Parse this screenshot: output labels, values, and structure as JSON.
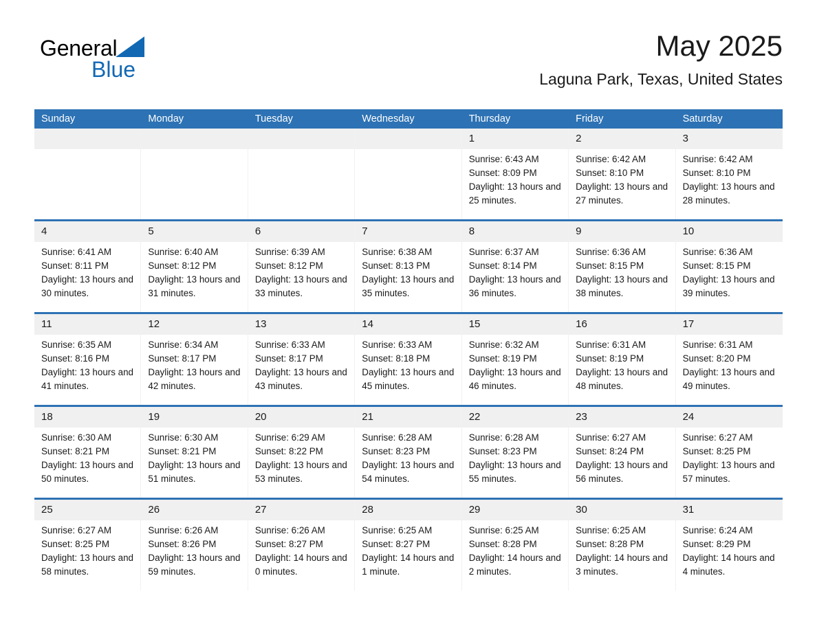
{
  "brand": {
    "name_part1": "General",
    "name_part2": "Blue",
    "accent_color": "#1268b3"
  },
  "header": {
    "month_title": "May 2025",
    "location": "Laguna Park, Texas, United States"
  },
  "colors": {
    "header_bar": "#2d72b4",
    "day_band": "#f0f0f0",
    "text": "#1a1a1a"
  },
  "weekdays": [
    "Sunday",
    "Monday",
    "Tuesday",
    "Wednesday",
    "Thursday",
    "Friday",
    "Saturday"
  ],
  "weeks": [
    [
      {
        "day": "",
        "sunrise": "",
        "sunset": "",
        "daylight": "",
        "empty": true
      },
      {
        "day": "",
        "sunrise": "",
        "sunset": "",
        "daylight": "",
        "empty": true
      },
      {
        "day": "",
        "sunrise": "",
        "sunset": "",
        "daylight": "",
        "empty": true
      },
      {
        "day": "",
        "sunrise": "",
        "sunset": "",
        "daylight": "",
        "empty": true
      },
      {
        "day": "1",
        "sunrise": "Sunrise: 6:43 AM",
        "sunset": "Sunset: 8:09 PM",
        "daylight": "Daylight: 13 hours and 25 minutes.",
        "empty": false
      },
      {
        "day": "2",
        "sunrise": "Sunrise: 6:42 AM",
        "sunset": "Sunset: 8:10 PM",
        "daylight": "Daylight: 13 hours and 27 minutes.",
        "empty": false
      },
      {
        "day": "3",
        "sunrise": "Sunrise: 6:42 AM",
        "sunset": "Sunset: 8:10 PM",
        "daylight": "Daylight: 13 hours and 28 minutes.",
        "empty": false
      }
    ],
    [
      {
        "day": "4",
        "sunrise": "Sunrise: 6:41 AM",
        "sunset": "Sunset: 8:11 PM",
        "daylight": "Daylight: 13 hours and 30 minutes.",
        "empty": false
      },
      {
        "day": "5",
        "sunrise": "Sunrise: 6:40 AM",
        "sunset": "Sunset: 8:12 PM",
        "daylight": "Daylight: 13 hours and 31 minutes.",
        "empty": false
      },
      {
        "day": "6",
        "sunrise": "Sunrise: 6:39 AM",
        "sunset": "Sunset: 8:12 PM",
        "daylight": "Daylight: 13 hours and 33 minutes.",
        "empty": false
      },
      {
        "day": "7",
        "sunrise": "Sunrise: 6:38 AM",
        "sunset": "Sunset: 8:13 PM",
        "daylight": "Daylight: 13 hours and 35 minutes.",
        "empty": false
      },
      {
        "day": "8",
        "sunrise": "Sunrise: 6:37 AM",
        "sunset": "Sunset: 8:14 PM",
        "daylight": "Daylight: 13 hours and 36 minutes.",
        "empty": false
      },
      {
        "day": "9",
        "sunrise": "Sunrise: 6:36 AM",
        "sunset": "Sunset: 8:15 PM",
        "daylight": "Daylight: 13 hours and 38 minutes.",
        "empty": false
      },
      {
        "day": "10",
        "sunrise": "Sunrise: 6:36 AM",
        "sunset": "Sunset: 8:15 PM",
        "daylight": "Daylight: 13 hours and 39 minutes.",
        "empty": false
      }
    ],
    [
      {
        "day": "11",
        "sunrise": "Sunrise: 6:35 AM",
        "sunset": "Sunset: 8:16 PM",
        "daylight": "Daylight: 13 hours and 41 minutes.",
        "empty": false
      },
      {
        "day": "12",
        "sunrise": "Sunrise: 6:34 AM",
        "sunset": "Sunset: 8:17 PM",
        "daylight": "Daylight: 13 hours and 42 minutes.",
        "empty": false
      },
      {
        "day": "13",
        "sunrise": "Sunrise: 6:33 AM",
        "sunset": "Sunset: 8:17 PM",
        "daylight": "Daylight: 13 hours and 43 minutes.",
        "empty": false
      },
      {
        "day": "14",
        "sunrise": "Sunrise: 6:33 AM",
        "sunset": "Sunset: 8:18 PM",
        "daylight": "Daylight: 13 hours and 45 minutes.",
        "empty": false
      },
      {
        "day": "15",
        "sunrise": "Sunrise: 6:32 AM",
        "sunset": "Sunset: 8:19 PM",
        "daylight": "Daylight: 13 hours and 46 minutes.",
        "empty": false
      },
      {
        "day": "16",
        "sunrise": "Sunrise: 6:31 AM",
        "sunset": "Sunset: 8:19 PM",
        "daylight": "Daylight: 13 hours and 48 minutes.",
        "empty": false
      },
      {
        "day": "17",
        "sunrise": "Sunrise: 6:31 AM",
        "sunset": "Sunset: 8:20 PM",
        "daylight": "Daylight: 13 hours and 49 minutes.",
        "empty": false
      }
    ],
    [
      {
        "day": "18",
        "sunrise": "Sunrise: 6:30 AM",
        "sunset": "Sunset: 8:21 PM",
        "daylight": "Daylight: 13 hours and 50 minutes.",
        "empty": false
      },
      {
        "day": "19",
        "sunrise": "Sunrise: 6:30 AM",
        "sunset": "Sunset: 8:21 PM",
        "daylight": "Daylight: 13 hours and 51 minutes.",
        "empty": false
      },
      {
        "day": "20",
        "sunrise": "Sunrise: 6:29 AM",
        "sunset": "Sunset: 8:22 PM",
        "daylight": "Daylight: 13 hours and 53 minutes.",
        "empty": false
      },
      {
        "day": "21",
        "sunrise": "Sunrise: 6:28 AM",
        "sunset": "Sunset: 8:23 PM",
        "daylight": "Daylight: 13 hours and 54 minutes.",
        "empty": false
      },
      {
        "day": "22",
        "sunrise": "Sunrise: 6:28 AM",
        "sunset": "Sunset: 8:23 PM",
        "daylight": "Daylight: 13 hours and 55 minutes.",
        "empty": false
      },
      {
        "day": "23",
        "sunrise": "Sunrise: 6:27 AM",
        "sunset": "Sunset: 8:24 PM",
        "daylight": "Daylight: 13 hours and 56 minutes.",
        "empty": false
      },
      {
        "day": "24",
        "sunrise": "Sunrise: 6:27 AM",
        "sunset": "Sunset: 8:25 PM",
        "daylight": "Daylight: 13 hours and 57 minutes.",
        "empty": false
      }
    ],
    [
      {
        "day": "25",
        "sunrise": "Sunrise: 6:27 AM",
        "sunset": "Sunset: 8:25 PM",
        "daylight": "Daylight: 13 hours and 58 minutes.",
        "empty": false
      },
      {
        "day": "26",
        "sunrise": "Sunrise: 6:26 AM",
        "sunset": "Sunset: 8:26 PM",
        "daylight": "Daylight: 13 hours and 59 minutes.",
        "empty": false
      },
      {
        "day": "27",
        "sunrise": "Sunrise: 6:26 AM",
        "sunset": "Sunset: 8:27 PM",
        "daylight": "Daylight: 14 hours and 0 minutes.",
        "empty": false
      },
      {
        "day": "28",
        "sunrise": "Sunrise: 6:25 AM",
        "sunset": "Sunset: 8:27 PM",
        "daylight": "Daylight: 14 hours and 1 minute.",
        "empty": false
      },
      {
        "day": "29",
        "sunrise": "Sunrise: 6:25 AM",
        "sunset": "Sunset: 8:28 PM",
        "daylight": "Daylight: 14 hours and 2 minutes.",
        "empty": false
      },
      {
        "day": "30",
        "sunrise": "Sunrise: 6:25 AM",
        "sunset": "Sunset: 8:28 PM",
        "daylight": "Daylight: 14 hours and 3 minutes.",
        "empty": false
      },
      {
        "day": "31",
        "sunrise": "Sunrise: 6:24 AM",
        "sunset": "Sunset: 8:29 PM",
        "daylight": "Daylight: 14 hours and 4 minutes.",
        "empty": false
      }
    ]
  ]
}
